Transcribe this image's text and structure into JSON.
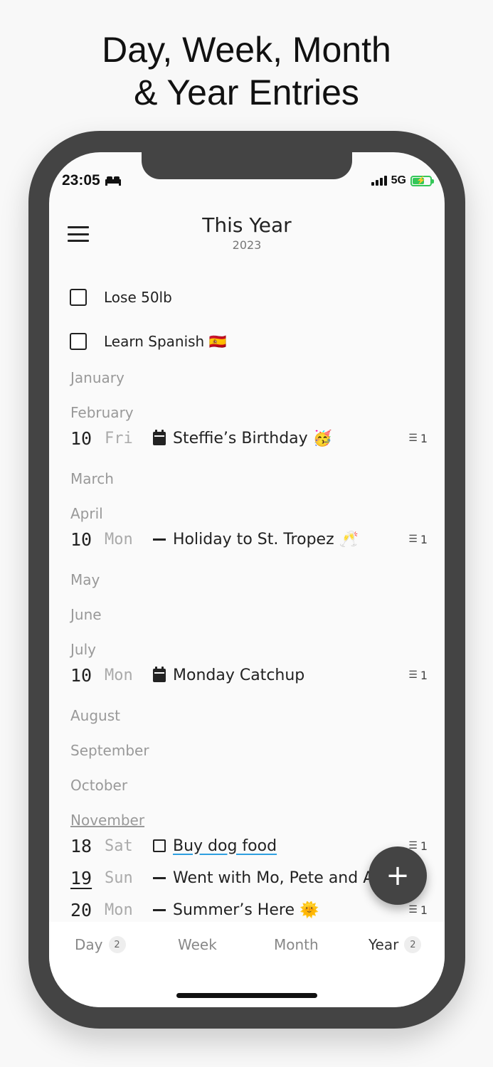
{
  "headline": {
    "line1": "Day, Week, Month",
    "line2": "& Year Entries"
  },
  "status": {
    "time": "23:05",
    "network": "5G",
    "battery_color": "#34c759"
  },
  "header": {
    "title": "This Year",
    "subtitle": "2023"
  },
  "goals": [
    {
      "text": "Lose 50lb",
      "checked": false
    },
    {
      "text": "Learn Spanish 🇪🇸",
      "checked": false
    }
  ],
  "months": {
    "january": "January",
    "february": "February",
    "march": "March",
    "april": "April",
    "may": "May",
    "june": "June",
    "july": "July",
    "august": "August",
    "september": "September",
    "october": "October",
    "november": "November"
  },
  "entries": [
    {
      "day": "10",
      "weekday": "Fri",
      "icon": "calendar-icon",
      "text": "Steffie’s Birthday 🥳",
      "count": "1"
    },
    {
      "day": "10",
      "weekday": "Mon",
      "icon": "dash-icon",
      "text": "Holiday to St. Tropez 🥂",
      "count": "1"
    },
    {
      "day": "10",
      "weekday": "Mon",
      "icon": "calendar-icon",
      "text": "Monday Catchup",
      "count": "1"
    },
    {
      "day": "18",
      "weekday": "Sat",
      "icon": "task-checkbox-icon",
      "text": "Buy dog food",
      "count": "1"
    },
    {
      "day": "19",
      "weekday": "Sun",
      "icon": "dash-icon",
      "text": "Went with Mo, Pete and A",
      "count": ""
    },
    {
      "day": "20",
      "weekday": "Mon",
      "icon": "dash-icon",
      "text": "Summer’s Here 🌞",
      "count": "1"
    }
  ],
  "fab": {
    "label": "+"
  },
  "tabs": [
    {
      "label": "Day",
      "count": "2"
    },
    {
      "label": "Week",
      "count": ""
    },
    {
      "label": "Month",
      "count": ""
    },
    {
      "label": "Year",
      "count": "2"
    }
  ]
}
